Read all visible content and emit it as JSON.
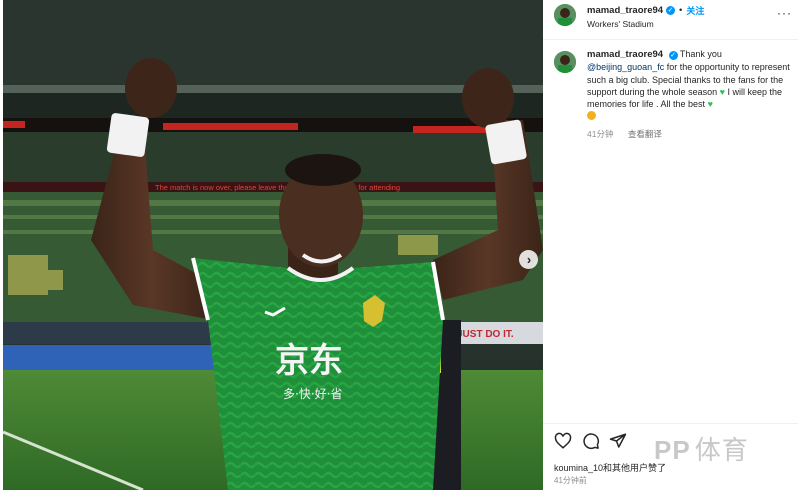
{
  "post": {
    "username": "mamad_traore94",
    "separator": "•",
    "follow_label": "关注",
    "location": "Workers' Stadium",
    "more_icon": "more-horizontal-icon"
  },
  "caption": {
    "username": "mamad_traore94",
    "part1": "Thank you",
    "mention": "@beijing_guoan_fc",
    "part2": "for the opportunity to represent such a big club. Special thanks to the fans for the support during the whole season",
    "part3": "I will keep the memories for life . All the best",
    "heart": "♥",
    "time": "41分钟",
    "translate_label": "查看翻译"
  },
  "photo": {
    "jersey_sponsor": "京东",
    "jersey_sub": "多·快·好·省",
    "stadium_banner": "The match is now over, please leave the stadium. Thank you for attending",
    "ad_text": "JUST DO IT.",
    "colors": {
      "jersey": "#1f8f3a",
      "pitch": "#3d7a2e",
      "stands": "#2f4a30"
    }
  },
  "actions": {
    "like_icon": "heart-icon",
    "comment_icon": "comment-icon",
    "share_icon": "share-icon",
    "watermark": "PP",
    "watermark_cn": "体育"
  },
  "likes_text": "koumina_10和其他用户赞了",
  "post_time": "41分钟前"
}
